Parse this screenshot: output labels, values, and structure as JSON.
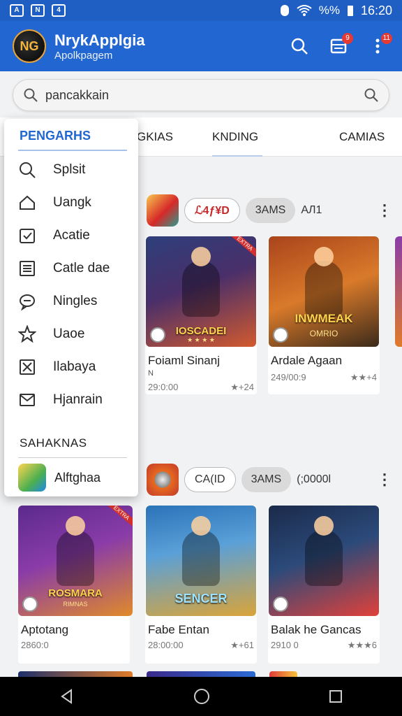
{
  "status_bar": {
    "left_icons": [
      "A",
      "N",
      "4"
    ],
    "battery": "%%",
    "time": "16:20"
  },
  "app_bar": {
    "title": "NrykApplgia",
    "subtitle": "Apolkpagem",
    "logo_text": "NG",
    "actions": [
      {
        "icon": "search-icon",
        "badge": ""
      },
      {
        "icon": "inbox-icon",
        "badge": "9"
      },
      {
        "icon": "more-vert-icon",
        "badge": "11"
      }
    ]
  },
  "search": {
    "value": "pancakkain",
    "placeholder": "pancakkain"
  },
  "tabs": [
    {
      "label": "PENGARHS",
      "active": true
    },
    {
      "label": "GKIAS",
      "active": false
    },
    {
      "label": "KNDING",
      "active": false
    },
    {
      "label": "CAMIAS",
      "active": false
    }
  ],
  "drawer": {
    "header": "PENGARHS",
    "items": [
      {
        "label": "Splsit",
        "icon": "search-icon"
      },
      {
        "label": "Uangk",
        "icon": "home-icon"
      },
      {
        "label": "Acatie",
        "icon": "checklist-icon"
      },
      {
        "label": "Catle dae",
        "icon": "list-icon"
      },
      {
        "label": "Ningles",
        "icon": "chat-icon"
      },
      {
        "label": "Uaoe",
        "icon": "star-icon"
      },
      {
        "label": "Ilabaya",
        "icon": "box-x-icon"
      },
      {
        "label": "Hjanrain",
        "icon": "mail-icon"
      }
    ],
    "section_label": "SAHAKNAS",
    "app_item": {
      "label": "Alftghaa",
      "icon": "app-thumbnail"
    }
  },
  "sections": [
    {
      "chip_outline": "ℒ4ƒ¥D",
      "chip_gray": "3AMS",
      "text": "AЛ1",
      "cards": [
        {
          "title": "Foiaml Sinanj",
          "sub": "N",
          "meta_left": "29:0:00",
          "meta_right": "★+24",
          "art_label": "IOSCADEI",
          "art_sub": "★ ★ ★ ★",
          "ribbon": "EXTRA",
          "colors": [
            "#2d3f7a",
            "#d25a2e"
          ]
        },
        {
          "title": "Ardale Agaan",
          "sub": "",
          "meta_left": "249/00:9",
          "meta_right": "★★+4",
          "art_label": "INWMEAK",
          "art_sub": "OMRIO",
          "ribbon": "",
          "colors": [
            "#a9441c",
            "#f3a03a"
          ]
        }
      ]
    },
    {
      "chip_outline": "CA(ID",
      "chip_gray": "3AMS",
      "text": "(;0000l",
      "cards": [
        {
          "title": "Aptotang",
          "sub": "",
          "meta_left": "2860:0",
          "meta_right": "",
          "art_label": "ROSMARA",
          "art_sub": "RIMNAS",
          "ribbon": "EXTRA",
          "colors": [
            "#5b2a8c",
            "#e08a2a"
          ]
        },
        {
          "title": "Fabe Entan",
          "sub": "",
          "meta_left": "28:00:00",
          "meta_right": "★+61",
          "art_label": "SENCER",
          "art_sub": "",
          "ribbon": "",
          "colors": [
            "#2a73b8",
            "#d9a43a"
          ]
        },
        {
          "title": "Balak he Gancas",
          "sub": "",
          "meta_left": "2910 0",
          "meta_right": "★★★6",
          "art_label": "",
          "art_sub": "",
          "ribbon": "",
          "colors": [
            "#1b2a4a",
            "#e1413a"
          ]
        }
      ]
    }
  ],
  "colors": {
    "primary": "#2266d2",
    "status_bar": "#1f5fc4",
    "background": "#f1f2f4"
  }
}
